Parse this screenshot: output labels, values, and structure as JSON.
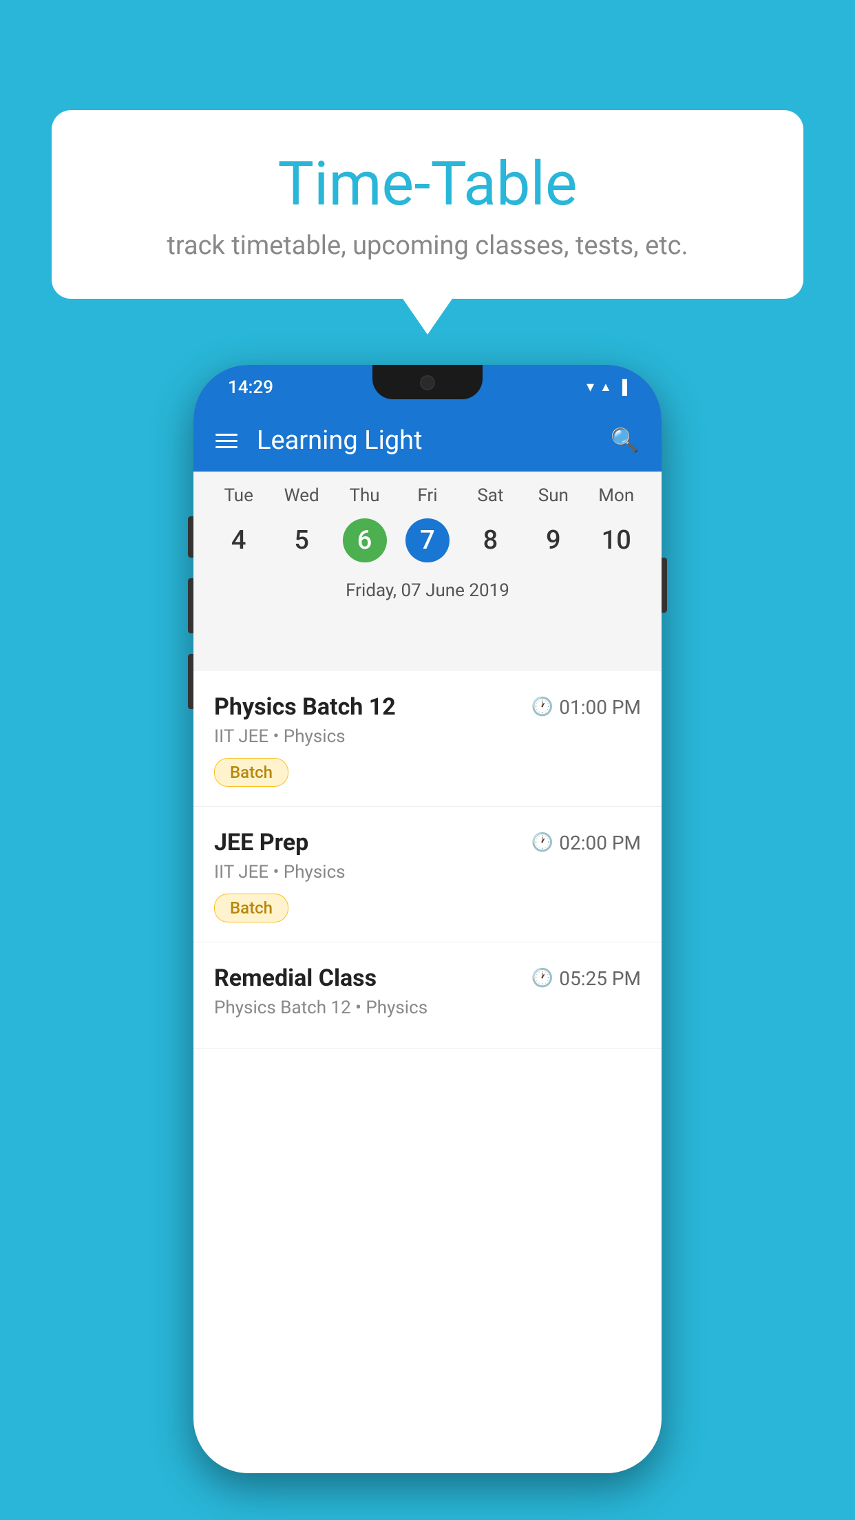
{
  "background_color": "#29B6D8",
  "bubble": {
    "title": "Time-Table",
    "subtitle": "track timetable, upcoming classes, tests, etc."
  },
  "phone": {
    "status_bar": {
      "time": "14:29"
    },
    "app_bar": {
      "title": "Learning Light"
    },
    "calendar": {
      "days": [
        "Tue",
        "Wed",
        "Thu",
        "Fri",
        "Sat",
        "Sun",
        "Mon"
      ],
      "dates": [
        "4",
        "5",
        "6",
        "7",
        "8",
        "9",
        "10"
      ],
      "today_index": 2,
      "selected_index": 3,
      "selected_label": "Friday, 07 June 2019"
    },
    "schedule": [
      {
        "title": "Physics Batch 12",
        "time": "01:00 PM",
        "subtitle": "IIT JEE • Physics",
        "tag": "Batch"
      },
      {
        "title": "JEE Prep",
        "time": "02:00 PM",
        "subtitle": "IIT JEE • Physics",
        "tag": "Batch"
      },
      {
        "title": "Remedial Class",
        "time": "05:25 PM",
        "subtitle": "Physics Batch 12 • Physics",
        "tag": ""
      }
    ]
  }
}
